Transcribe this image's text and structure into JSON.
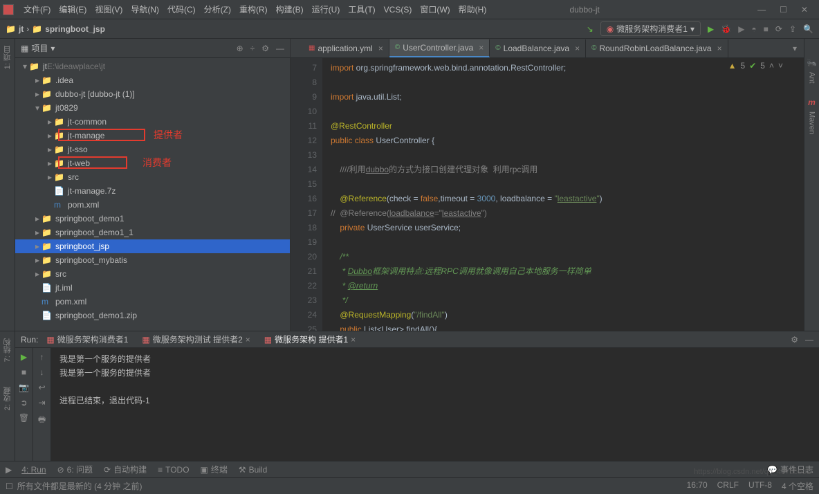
{
  "title": {
    "project": "dubbo-jt"
  },
  "menu": [
    "文件(F)",
    "编辑(E)",
    "视图(V)",
    "导航(N)",
    "代码(C)",
    "分析(Z)",
    "重构(R)",
    "构建(B)",
    "运行(U)",
    "工具(T)",
    "VCS(S)",
    "窗口(W)",
    "帮助(H)"
  ],
  "breadcrumb": {
    "root": "jt",
    "current": "springboot_jsp"
  },
  "run_config": "微服务架构消费者1",
  "project_panel": {
    "title": "项目"
  },
  "tree": [
    {
      "indent": 0,
      "arrow": "▾",
      "icon": "📁",
      "label": "jt",
      "suffix": " E:\\ideawplace\\jt",
      "suffixDim": true
    },
    {
      "indent": 1,
      "arrow": "▸",
      "icon": "📁",
      "label": ".idea"
    },
    {
      "indent": 1,
      "arrow": "▸",
      "icon": "📁",
      "label": "dubbo-jt [dubbo-jt (1)]"
    },
    {
      "indent": 1,
      "arrow": "▾",
      "icon": "📁",
      "label": "jt0829"
    },
    {
      "indent": 2,
      "arrow": "▸",
      "icon": "📁",
      "label": "jt-common"
    },
    {
      "indent": 2,
      "arrow": "▸",
      "icon": "📁",
      "label": "jt-manage",
      "boxed": true
    },
    {
      "indent": 2,
      "arrow": "▸",
      "icon": "📁",
      "label": "jt-sso"
    },
    {
      "indent": 2,
      "arrow": "▸",
      "icon": "📁",
      "label": "jt-web",
      "boxed": true
    },
    {
      "indent": 2,
      "arrow": "▸",
      "icon": "📁",
      "label": "src"
    },
    {
      "indent": 2,
      "arrow": "",
      "icon": "📄",
      "label": "jt-manage.7z"
    },
    {
      "indent": 2,
      "arrow": "",
      "icon": "m",
      "label": "pom.xml",
      "iconColor": "#4a88c7"
    },
    {
      "indent": 1,
      "arrow": "▸",
      "icon": "📁",
      "label": "springboot_demo1"
    },
    {
      "indent": 1,
      "arrow": "▸",
      "icon": "📁",
      "label": "springboot_demo1_1"
    },
    {
      "indent": 1,
      "arrow": "▸",
      "icon": "📁",
      "label": "springboot_jsp",
      "selected": true
    },
    {
      "indent": 1,
      "arrow": "▸",
      "icon": "📁",
      "label": "springboot_mybatis"
    },
    {
      "indent": 1,
      "arrow": "▸",
      "icon": "📁",
      "label": "src"
    },
    {
      "indent": 1,
      "arrow": "",
      "icon": "📄",
      "label": "jt.iml"
    },
    {
      "indent": 1,
      "arrow": "",
      "icon": "m",
      "label": "pom.xml",
      "iconColor": "#4a88c7"
    },
    {
      "indent": 1,
      "arrow": "",
      "icon": "📄",
      "label": "springboot_demo1.zip"
    }
  ],
  "red_labels": {
    "provider": "提供者",
    "consumer": "消费者"
  },
  "editor_tabs": [
    {
      "label": "application.yml",
      "icon": "yml",
      "active": false
    },
    {
      "label": "UserController.java",
      "icon": "java",
      "active": true
    },
    {
      "label": "LoadBalance.java",
      "icon": "java",
      "active": false
    },
    {
      "label": "RoundRobinLoadBalance.java",
      "icon": "java",
      "active": false
    }
  ],
  "editor_indicators": {
    "warn": "5",
    "ok": "5"
  },
  "code_lines": [
    {
      "n": 7,
      "html": "<span class='kw'>import</span> org.springframework.web.bind.annotation.RestController;"
    },
    {
      "n": 8,
      "html": ""
    },
    {
      "n": 9,
      "html": "<span class='kw'>import</span> java.util.List;"
    },
    {
      "n": 10,
      "html": ""
    },
    {
      "n": 11,
      "html": "<span class='ann'>@RestController</span>"
    },
    {
      "n": 12,
      "html": "<span class='kw'>public class</span> <span class='type'>UserController</span> {"
    },
    {
      "n": 13,
      "html": ""
    },
    {
      "n": 14,
      "html": "    <span class='com'>////利用<span class='underline'>dubbo</span>的方式为接口创建代理对象  利用rpc调用</span>"
    },
    {
      "n": 15,
      "html": ""
    },
    {
      "n": 16,
      "html": "    <span class='ann'>@Reference</span>(check = <span class='kw'>false</span>,timeout = <span class='num'>3000</span>, loadbalance = <span class='str'>\"<span class='underline'>leastactive</span>\"</span>)"
    },
    {
      "n": 17,
      "html": "<span class='com'>//  @Reference(<span class='underline'>loadbalance</span>=\"<span class='underline'>leastactive</span>\")</span>"
    },
    {
      "n": 18,
      "html": "    <span class='kw'>private</span> UserService <span class='ident'>userService</span>;"
    },
    {
      "n": 19,
      "html": ""
    },
    {
      "n": 20,
      "html": "    <span class='doc'>/**</span>"
    },
    {
      "n": 21,
      "html": "    <span class='doc'> * <span class='doc-tag'>Dubbo</span>框架调用特点:远程RPC调用就像调用自己本地服务一样简单</span>"
    },
    {
      "n": 22,
      "html": "    <span class='doc'> * <span class='doc-tag'>@return</span></span>"
    },
    {
      "n": 23,
      "html": "    <span class='doc'> */</span>"
    },
    {
      "n": 24,
      "html": "    <span class='ann'>@RequestMapping</span>(<span class='str'>\"/findAll\"</span>)"
    },
    {
      "n": 25,
      "html": "    <span class='kw'>public</span> List&lt;User&gt; findAll(){"
    }
  ],
  "run_panel": {
    "label": "Run:",
    "tabs": [
      {
        "label": "微服务架构消费者1",
        "active": false
      },
      {
        "label": "微服务架构测试 提供者2",
        "active": false,
        "close": true
      },
      {
        "label": "微服务架构 提供者1",
        "active": true,
        "close": true
      }
    ],
    "output": [
      "我是第一个服务的提供者",
      "我是第一个服务的提供者",
      "",
      "进程已结束，退出代码-1"
    ]
  },
  "bottom_tabs": [
    "4: Run",
    "6: 问题",
    "自动构建",
    "TODO",
    "终端",
    "Build"
  ],
  "bottom_right": "事件日志",
  "status": {
    "left": "所有文件都是最新的 (4 分钟 之前)",
    "right": [
      "16:70",
      "CRLF",
      "UTF-8",
      "4 个空格"
    ]
  },
  "side_labels": {
    "left_top": "1: 项目",
    "left_mid": "7: 结构",
    "left_bot": "2: 收藏",
    "right_top": "Ant",
    "right_bot": "Maven"
  },
  "watermark": "https://blog.csdn.net/qq_43765681"
}
